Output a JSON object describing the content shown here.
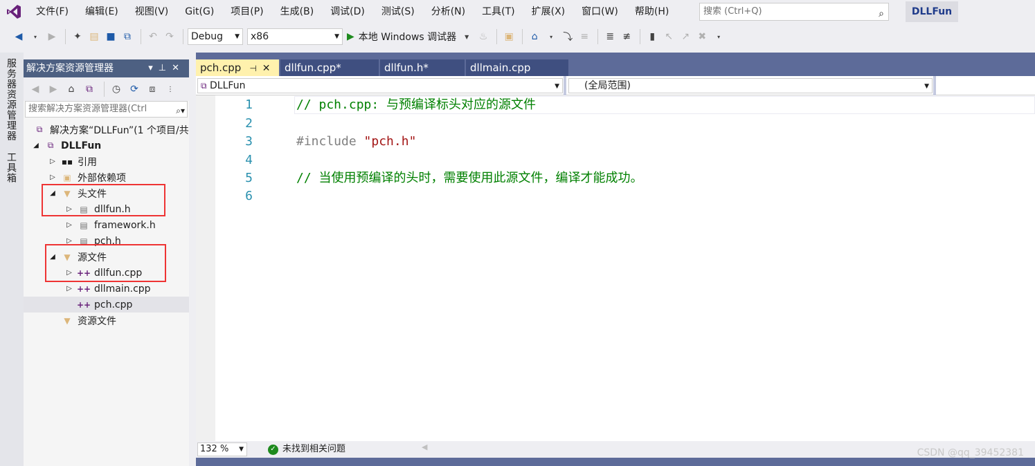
{
  "menubar": {
    "items": [
      "文件(F)",
      "编辑(E)",
      "视图(V)",
      "Git(G)",
      "项目(P)",
      "生成(B)",
      "调试(D)",
      "测试(S)",
      "分析(N)",
      "工具(T)",
      "扩展(X)",
      "窗口(W)",
      "帮助(H)"
    ],
    "search_placeholder": "搜索 (Ctrl+Q)",
    "project_name": "DLLFun"
  },
  "toolbar": {
    "configuration": "Debug",
    "platform": "x86",
    "debugger_label": "本地 Windows 调试器"
  },
  "side_tabs": {
    "server_explorer": "服务器资源管理器",
    "toolbox": "工具箱"
  },
  "explorer": {
    "title": "解决方案资源管理器",
    "search_placeholder": "搜索解决方案资源管理器(Ctrl",
    "tree": [
      {
        "label": "解决方案“DLLFun”(1 个项目/共",
        "level": 0,
        "icon": "solution-icon",
        "twisty": ""
      },
      {
        "label": "DLLFun",
        "level": 0,
        "icon": "project-icon",
        "twisty": "open"
      },
      {
        "label": "引用",
        "level": 1,
        "icon": "references-icon",
        "twisty": "closed"
      },
      {
        "label": "外部依赖项",
        "level": 1,
        "icon": "external-deps-icon",
        "twisty": "closed"
      },
      {
        "label": "头文件",
        "level": 1,
        "icon": "folder-icon",
        "twisty": "open"
      },
      {
        "label": "dllfun.h",
        "level": 2,
        "icon": "header-file-icon",
        "twisty": "closed"
      },
      {
        "label": "framework.h",
        "level": 2,
        "icon": "header-file-icon",
        "twisty": "closed"
      },
      {
        "label": "pch.h",
        "level": 2,
        "icon": "header-file-icon",
        "twisty": "closed"
      },
      {
        "label": "源文件",
        "level": 1,
        "icon": "folder-icon",
        "twisty": "open"
      },
      {
        "label": "dllfun.cpp",
        "level": 2,
        "icon": "cpp-file-icon",
        "twisty": "closed"
      },
      {
        "label": "dllmain.cpp",
        "level": 2,
        "icon": "cpp-file-icon",
        "twisty": "closed"
      },
      {
        "label": "pch.cpp",
        "level": 2,
        "icon": "cpp-file-icon",
        "twisty": ""
      },
      {
        "label": "资源文件",
        "level": 1,
        "icon": "folder-icon",
        "twisty": ""
      }
    ]
  },
  "tabs": [
    {
      "label": "pch.cpp",
      "active": true
    },
    {
      "label": "dllfun.cpp*",
      "active": false
    },
    {
      "label": "dllfun.h*",
      "active": false
    },
    {
      "label": "dllmain.cpp",
      "active": false
    }
  ],
  "navbar": {
    "project": "DLLFun",
    "scope": "(全局范围)"
  },
  "code": {
    "line_numbers": [
      "1",
      "2",
      "3",
      "4",
      "5",
      "6"
    ],
    "line1": "// pch.cpp: 与预编译标头对应的源文件",
    "line3_directive": "#include",
    "line3_string": "\"pch.h\"",
    "line5": "// 当使用预编译的头时，需要使用此源文件，编译才能成功。"
  },
  "status": {
    "zoom": "132 %",
    "issues": "未找到相关问题"
  },
  "watermark": "CSDN @qq_39452381"
}
